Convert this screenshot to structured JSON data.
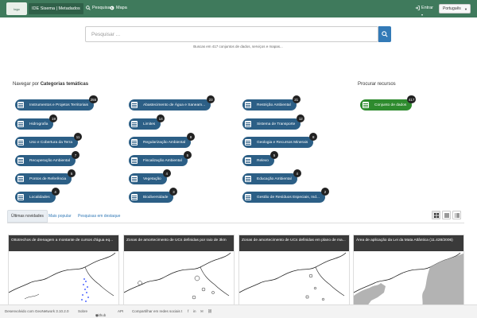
{
  "header": {
    "logo_text": "logo",
    "brand": "IDE Sisema | Metadados",
    "nav": [
      {
        "label": "Pesquisar",
        "icon": "search-icon"
      },
      {
        "label": "Mapa",
        "icon": "globe-icon"
      }
    ],
    "login": "Entrar",
    "language": "Português"
  },
  "search": {
    "placeholder": "Pesquisar ...",
    "stats": "Buscas em 417 conjuntos de dados, serviços e mapas..."
  },
  "categories": {
    "title_prefix": "Navegar por ",
    "title_bold": "Categorias temáticas",
    "items": [
      {
        "label": "Instrumentos e Projetos Territoriais",
        "count": "255"
      },
      {
        "label": "Hidrografia",
        "count": "19"
      },
      {
        "label": "Uso e Cobertura da Terra",
        "count": "11"
      },
      {
        "label": "Recuperação Ambiental",
        "count": "7"
      },
      {
        "label": "Pontos de Referência",
        "count": "5"
      },
      {
        "label": "Localidades",
        "count": "4"
      },
      {
        "label": "Abastecimento de Água e Saneam...",
        "count": "23"
      },
      {
        "label": "Limites",
        "count": "14"
      },
      {
        "label": "Regularização Ambiental",
        "count": "8"
      },
      {
        "label": "Fiscalização Ambiental",
        "count": "5"
      },
      {
        "label": "Vegetação",
        "count": "4"
      },
      {
        "label": "Biodiversidade",
        "count": "3"
      },
      {
        "label": "Restrição Ambiental",
        "count": "21"
      },
      {
        "label": "Sistema de Transporte",
        "count": "12"
      },
      {
        "label": "Geologia e Recursos Minerais",
        "count": "8"
      },
      {
        "label": "Relevo",
        "count": "5"
      },
      {
        "label": "Educação Ambiental",
        "count": "4"
      },
      {
        "label": "Gestão de Resíduos Especiais, Ind...",
        "count": "2"
      }
    ]
  },
  "resources": {
    "title": "Procurar recursos",
    "items": [
      {
        "label": "Conjunto de dados",
        "count": "417"
      }
    ]
  },
  "tabs": [
    {
      "label": "Últimas novidades",
      "active": true
    },
    {
      "label": "Mais popular",
      "active": false
    },
    {
      "label": "Pesquisas em destaque",
      "active": false
    }
  ],
  "cards": [
    {
      "title": "Ottotrechos de drenagem a montante de cursos d'água eq..."
    },
    {
      "title": "Zonas de amortecimento de UCs definidas por raio de 3km"
    },
    {
      "title": "Zonas de amortecimento de UCs definidas em plano de ma..."
    },
    {
      "title": "Área de aplicação da Lei da Mata Atlântica (11.428/2006)"
    }
  ],
  "footer": {
    "powered": "Desenvolvido com GeoNetwork 3.10.2.0",
    "about": "Sobre",
    "github": "Github",
    "api": "API",
    "share": "Compartilhar em redes sociais"
  },
  "colors": {
    "topbar": "#3f7a5c",
    "chip": "#2c5f86",
    "chip_green": "#2e8b2e",
    "search_button": "#337ab7"
  }
}
